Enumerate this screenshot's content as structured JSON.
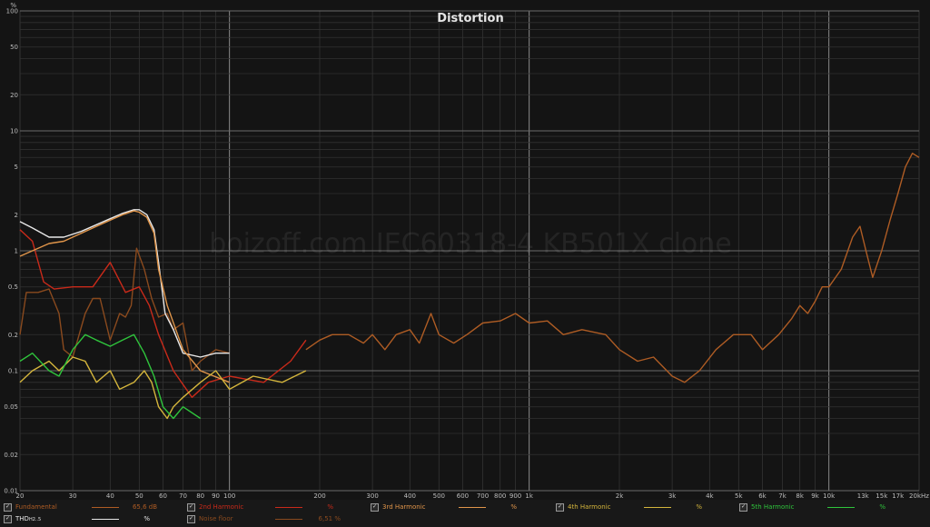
{
  "chart_data": {
    "type": "line",
    "title": "Distortion",
    "watermark": "boizoff.com IEC60318-4 KB501X clone",
    "y_unit": "%",
    "xscale": "log",
    "yscale": "log",
    "xlim": [
      20,
      20000
    ],
    "ylim": [
      0.01,
      100
    ],
    "grid": true,
    "x_ticks": [
      {
        "v": 20,
        "label": "20"
      },
      {
        "v": 30,
        "label": "30"
      },
      {
        "v": 40,
        "label": "40"
      },
      {
        "v": 50,
        "label": "50"
      },
      {
        "v": 60,
        "label": "60"
      },
      {
        "v": 70,
        "label": "70"
      },
      {
        "v": 80,
        "label": "80"
      },
      {
        "v": 90,
        "label": "90"
      },
      {
        "v": 100,
        "label": "100"
      },
      {
        "v": 200,
        "label": "200"
      },
      {
        "v": 300,
        "label": "300"
      },
      {
        "v": 400,
        "label": "400"
      },
      {
        "v": 500,
        "label": "500"
      },
      {
        "v": 600,
        "label": "600"
      },
      {
        "v": 700,
        "label": "700"
      },
      {
        "v": 800,
        "label": "800"
      },
      {
        "v": 900,
        "label": "900"
      },
      {
        "v": 1000,
        "label": "1k"
      },
      {
        "v": 2000,
        "label": "2k"
      },
      {
        "v": 3000,
        "label": "3k"
      },
      {
        "v": 4000,
        "label": "4k"
      },
      {
        "v": 5000,
        "label": "5k"
      },
      {
        "v": 6000,
        "label": "6k"
      },
      {
        "v": 7000,
        "label": "7k"
      },
      {
        "v": 8000,
        "label": "8k"
      },
      {
        "v": 9000,
        "label": "9k"
      },
      {
        "v": 10000,
        "label": "10k"
      },
      {
        "v": 13000,
        "label": "13k"
      },
      {
        "v": 15000,
        "label": "15k"
      },
      {
        "v": 17000,
        "label": "17k"
      },
      {
        "v": 20000,
        "label": "20kHz"
      }
    ],
    "y_ticks": [
      {
        "v": 100,
        "label": "100"
      },
      {
        "v": 50,
        "label": "50"
      },
      {
        "v": 20,
        "label": "20"
      },
      {
        "v": 10,
        "label": "10"
      },
      {
        "v": 5,
        "label": "5"
      },
      {
        "v": 2,
        "label": "2"
      },
      {
        "v": 1,
        "label": "1"
      },
      {
        "v": 0.5,
        "label": "0.5"
      },
      {
        "v": 0.2,
        "label": "0.2"
      },
      {
        "v": 0.1,
        "label": "0.1"
      },
      {
        "v": 0.05,
        "label": "0.05"
      },
      {
        "v": 0.02,
        "label": "0.02"
      },
      {
        "v": 0.01,
        "label": "0.01"
      }
    ],
    "series": [
      {
        "name": "Noise floor",
        "color": "#8a4a1e",
        "points": [
          [
            20,
            0.2
          ],
          [
            21,
            0.45
          ],
          [
            23,
            0.45
          ],
          [
            25,
            0.48
          ],
          [
            27,
            0.3
          ],
          [
            28,
            0.15
          ],
          [
            30,
            0.13
          ],
          [
            33,
            0.3
          ],
          [
            35,
            0.4
          ],
          [
            37,
            0.4
          ],
          [
            40,
            0.18
          ],
          [
            43,
            0.3
          ],
          [
            45,
            0.28
          ],
          [
            47,
            0.35
          ],
          [
            49,
            1.05
          ],
          [
            52,
            0.7
          ],
          [
            55,
            0.4
          ],
          [
            58,
            0.28
          ],
          [
            62,
            0.3
          ],
          [
            65,
            0.22
          ],
          [
            70,
            0.25
          ],
          [
            75,
            0.1
          ],
          [
            80,
            0.12
          ],
          [
            90,
            0.15
          ],
          [
            100,
            0.14
          ]
        ]
      },
      {
        "name": "Fundamental",
        "color": "#ae5c24",
        "points": [
          [
            180,
            0.15
          ],
          [
            200,
            0.18
          ],
          [
            220,
            0.2
          ],
          [
            250,
            0.2
          ],
          [
            280,
            0.17
          ],
          [
            300,
            0.2
          ],
          [
            330,
            0.15
          ],
          [
            360,
            0.2
          ],
          [
            400,
            0.22
          ],
          [
            430,
            0.17
          ],
          [
            470,
            0.3
          ],
          [
            500,
            0.2
          ],
          [
            560,
            0.17
          ],
          [
            620,
            0.2
          ],
          [
            700,
            0.25
          ],
          [
            800,
            0.26
          ],
          [
            900,
            0.3
          ],
          [
            1000,
            0.25
          ],
          [
            1150,
            0.26
          ],
          [
            1300,
            0.2
          ],
          [
            1500,
            0.22
          ],
          [
            1800,
            0.2
          ],
          [
            2000,
            0.15
          ],
          [
            2300,
            0.12
          ],
          [
            2600,
            0.13
          ],
          [
            3000,
            0.09
          ],
          [
            3300,
            0.08
          ],
          [
            3700,
            0.1
          ],
          [
            4200,
            0.15
          ],
          [
            4800,
            0.2
          ],
          [
            5500,
            0.2
          ],
          [
            6000,
            0.15
          ],
          [
            6800,
            0.2
          ],
          [
            7500,
            0.27
          ],
          [
            8000,
            0.35
          ],
          [
            8500,
            0.3
          ],
          [
            9000,
            0.38
          ],
          [
            9500,
            0.5
          ],
          [
            10000,
            0.5
          ],
          [
            11000,
            0.7
          ],
          [
            12000,
            1.3
          ],
          [
            12700,
            1.6
          ],
          [
            13300,
            1.0
          ],
          [
            14000,
            0.6
          ],
          [
            15000,
            1.0
          ],
          [
            16000,
            1.8
          ],
          [
            17000,
            3.0
          ],
          [
            18000,
            5.0
          ],
          [
            19000,
            6.5
          ],
          [
            20000,
            6.0
          ]
        ]
      },
      {
        "name": "THD",
        "color": "#e8e8e8",
        "points": [
          [
            20,
            1.75
          ],
          [
            22,
            1.55
          ],
          [
            25,
            1.3
          ],
          [
            28,
            1.3
          ],
          [
            32,
            1.45
          ],
          [
            36,
            1.65
          ],
          [
            40,
            1.85
          ],
          [
            44,
            2.05
          ],
          [
            48,
            2.2
          ],
          [
            50,
            2.2
          ],
          [
            53,
            2.0
          ],
          [
            56,
            1.5
          ],
          [
            58,
            0.8
          ],
          [
            61,
            0.3
          ],
          [
            65,
            0.22
          ],
          [
            70,
            0.14
          ],
          [
            80,
            0.13
          ],
          [
            90,
            0.14
          ],
          [
            100,
            0.14
          ]
        ]
      },
      {
        "name": "2nd Harmonic",
        "color": "#c92a1a",
        "points": [
          [
            20,
            1.5
          ],
          [
            22,
            1.2
          ],
          [
            24,
            0.55
          ],
          [
            26,
            0.48
          ],
          [
            30,
            0.5
          ],
          [
            35,
            0.5
          ],
          [
            40,
            0.8
          ],
          [
            45,
            0.45
          ],
          [
            50,
            0.5
          ],
          [
            54,
            0.35
          ],
          [
            58,
            0.2
          ],
          [
            65,
            0.1
          ],
          [
            75,
            0.06
          ],
          [
            85,
            0.08
          ],
          [
            100,
            0.09
          ],
          [
            130,
            0.08
          ],
          [
            160,
            0.12
          ],
          [
            180,
            0.18
          ]
        ]
      },
      {
        "name": "3rd Harmonic",
        "color": "#e0954a",
        "points": [
          [
            20,
            0.9
          ],
          [
            22,
            1.0
          ],
          [
            25,
            1.15
          ],
          [
            28,
            1.2
          ],
          [
            32,
            1.4
          ],
          [
            36,
            1.6
          ],
          [
            40,
            1.8
          ],
          [
            44,
            2.0
          ],
          [
            48,
            2.15
          ],
          [
            50,
            2.1
          ],
          [
            53,
            1.9
          ],
          [
            56,
            1.4
          ],
          [
            58,
            0.7
          ],
          [
            62,
            0.35
          ],
          [
            70,
            0.15
          ],
          [
            80,
            0.1
          ],
          [
            100,
            0.08
          ]
        ]
      },
      {
        "name": "4th Harmonic",
        "color": "#d4b53c",
        "points": [
          [
            20,
            0.08
          ],
          [
            22,
            0.1
          ],
          [
            25,
            0.12
          ],
          [
            27,
            0.1
          ],
          [
            30,
            0.13
          ],
          [
            33,
            0.12
          ],
          [
            36,
            0.08
          ],
          [
            40,
            0.1
          ],
          [
            43,
            0.07
          ],
          [
            48,
            0.08
          ],
          [
            52,
            0.1
          ],
          [
            55,
            0.08
          ],
          [
            58,
            0.05
          ],
          [
            62,
            0.04
          ],
          [
            65,
            0.05
          ],
          [
            70,
            0.06
          ],
          [
            80,
            0.08
          ],
          [
            90,
            0.1
          ],
          [
            100,
            0.07
          ],
          [
            120,
            0.09
          ],
          [
            150,
            0.08
          ],
          [
            180,
            0.1
          ]
        ]
      },
      {
        "name": "5th Harmonic",
        "color": "#2fc43c",
        "points": [
          [
            20,
            0.12
          ],
          [
            22,
            0.14
          ],
          [
            25,
            0.1
          ],
          [
            27,
            0.09
          ],
          [
            30,
            0.15
          ],
          [
            33,
            0.2
          ],
          [
            36,
            0.18
          ],
          [
            40,
            0.16
          ],
          [
            44,
            0.18
          ],
          [
            48,
            0.2
          ],
          [
            52,
            0.14
          ],
          [
            56,
            0.09
          ],
          [
            60,
            0.05
          ],
          [
            65,
            0.04
          ],
          [
            70,
            0.05
          ],
          [
            80,
            0.04
          ]
        ]
      }
    ]
  },
  "legend": [
    {
      "name": "Fundamental",
      "value": "65,6 dB",
      "unit": "",
      "color": "#ae5c24",
      "checked": true
    },
    {
      "name": "2nd Harmonic",
      "value": "",
      "unit": "%",
      "color": "#c92a1a",
      "checked": true
    },
    {
      "name": "3rd Harmonic",
      "value": "",
      "unit": "%",
      "color": "#e0954a",
      "checked": true
    },
    {
      "name": "4th Harmonic",
      "value": "",
      "unit": "%",
      "color": "#d4b53c",
      "checked": true
    },
    {
      "name": "5th Harmonic",
      "value": "",
      "unit": "%",
      "color": "#2fc43c",
      "checked": true
    },
    {
      "name": "THD",
      "sub": "H2..5",
      "value": "",
      "unit": "%",
      "color": "#e8e8e8",
      "checked": true
    },
    {
      "name": "Noise floor",
      "value": "6,51 %",
      "unit": "",
      "color": "#8a4a1e",
      "checked": true
    }
  ],
  "checkmark": "✓"
}
